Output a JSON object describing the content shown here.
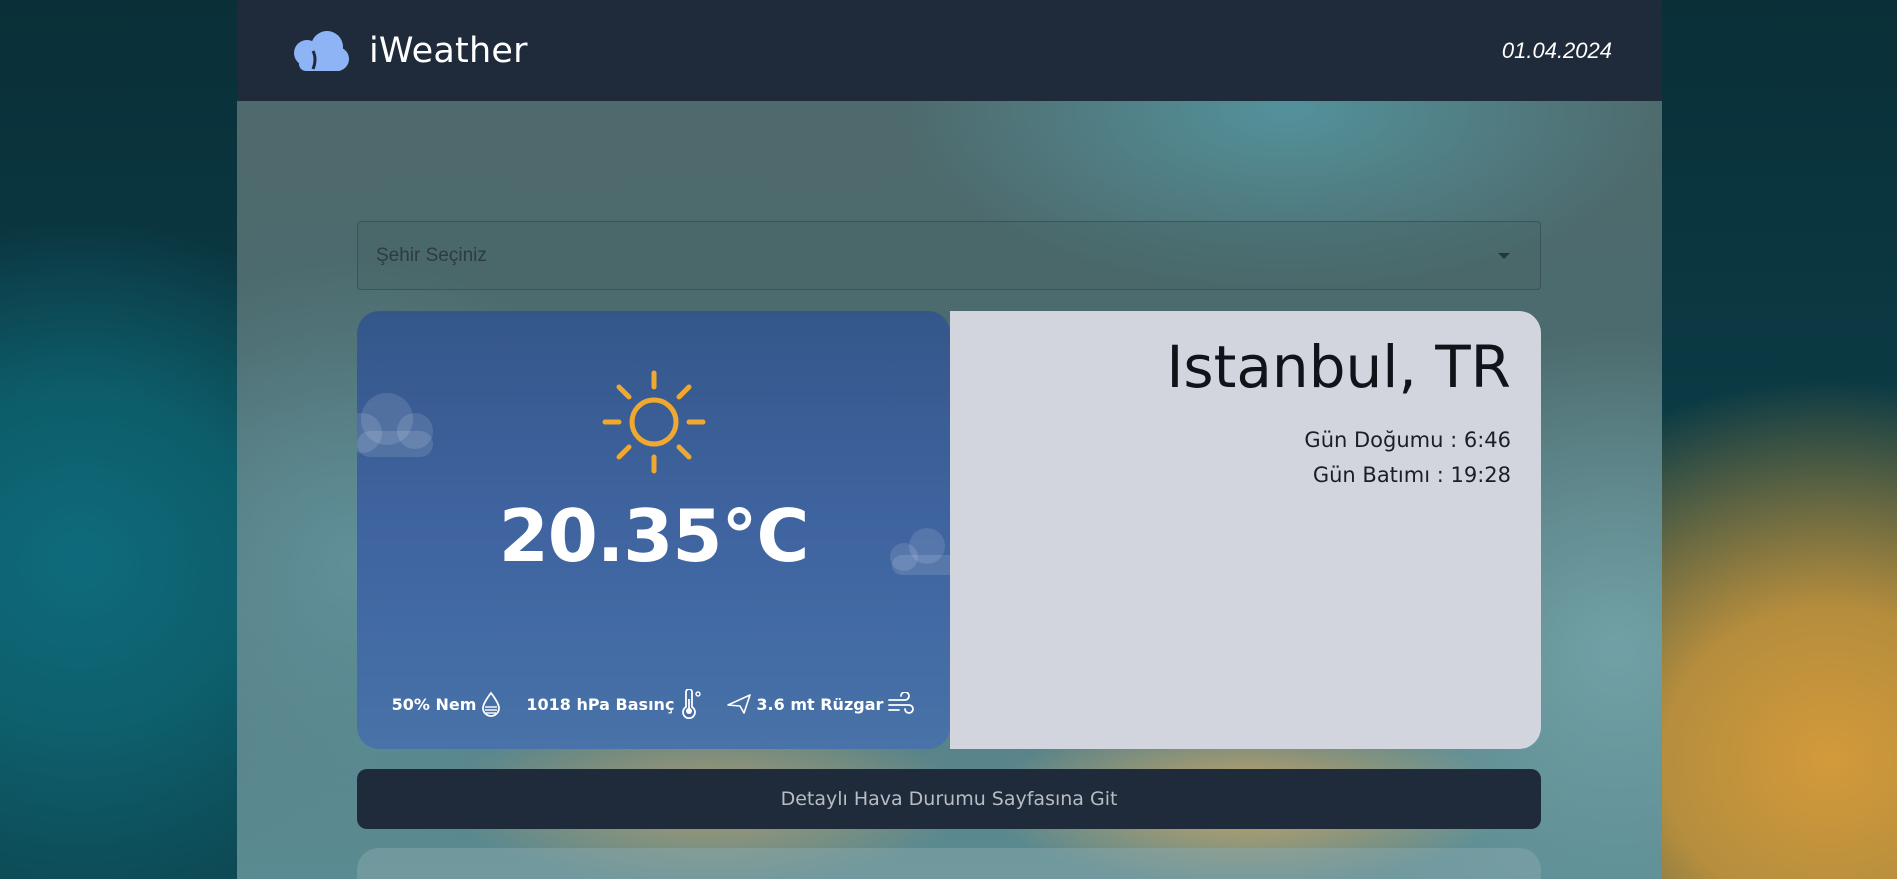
{
  "navbar": {
    "brand_name": "iWeather",
    "brand_icon": "cloud-icon",
    "date": "01.04.2024"
  },
  "city_select": {
    "placeholder": "Şehir Seçiniz"
  },
  "weather": {
    "condition_icon": "sun-icon",
    "temperature": "20.35°C",
    "humidity": "50% Nem",
    "pressure": "1018 hPa Basınç",
    "wind": "3.6 mt Rüzgar",
    "city": "Istanbul, TR",
    "sunrise": "Gün Doğumu : 6:46",
    "sunset": "Gün Batımı : 19:28"
  },
  "actions": {
    "detail_button": "Detaylı Hava Durumu Sayfasına Git"
  },
  "colors": {
    "navbar_bg": "#1f2a3a",
    "card_left_bg": "#3f64a0",
    "card_right_bg": "#d3d5de",
    "sun_color": "#f0a830",
    "brand_icon_color": "#8fb4f5"
  }
}
